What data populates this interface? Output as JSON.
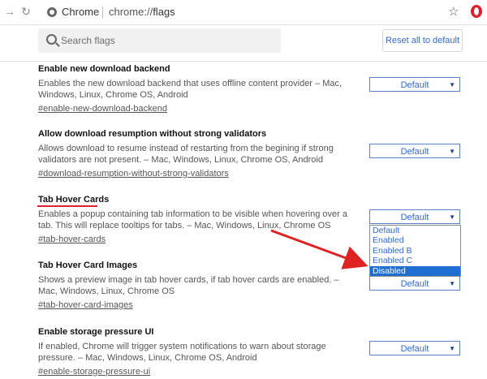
{
  "browser": {
    "site_name": "Chrome",
    "url_prefix": "chrome://",
    "url_path": "flags"
  },
  "header": {
    "search_placeholder": "Search flags",
    "reset_label": "Reset all to default"
  },
  "flags": [
    {
      "title": "Enable new download backend",
      "description": "Enables the new download backend that uses offline content provider – Mac, Windows, Linux, Chrome OS, Android",
      "link": "#enable-new-download-backend",
      "value": "Default"
    },
    {
      "title": "Allow download resumption without strong validators",
      "description": "Allows download to resume instead of restarting from the begining if strong validators are not present. – Mac, Windows, Linux, Chrome OS, Android",
      "link": "#download-resumption-without-strong-validators",
      "value": "Default"
    },
    {
      "title": "Tab Hover Cards",
      "description": "Enables a popup containing tab information to be visible when hovering over a tab. This will replace tooltips for tabs. – Mac, Windows, Linux, Chrome OS",
      "link": "#tab-hover-cards",
      "value": "Default"
    },
    {
      "title": "Tab Hover Card Images",
      "description": "Shows a preview image in tab hover cards, if tab hover cards are enabled. – Mac, Windows, Linux, Chrome OS",
      "link": "#tab-hover-card-images",
      "value": "Default"
    },
    {
      "title": "Enable storage pressure UI",
      "description": "If enabled, Chrome will trigger system notifications to warn about storage pressure. – Mac, Windows, Linux, Chrome OS, Android",
      "link": "#enable-storage-pressure-ui",
      "value": "Default"
    }
  ],
  "dropdown": {
    "options": [
      "Default",
      "Enabled",
      "Enabled B",
      "Enabled C",
      "Disabled"
    ],
    "selected": "Disabled"
  },
  "colors": {
    "accent": "#3367d6",
    "selection": "#1f6fd1",
    "annotation_red": "#dd2222"
  }
}
